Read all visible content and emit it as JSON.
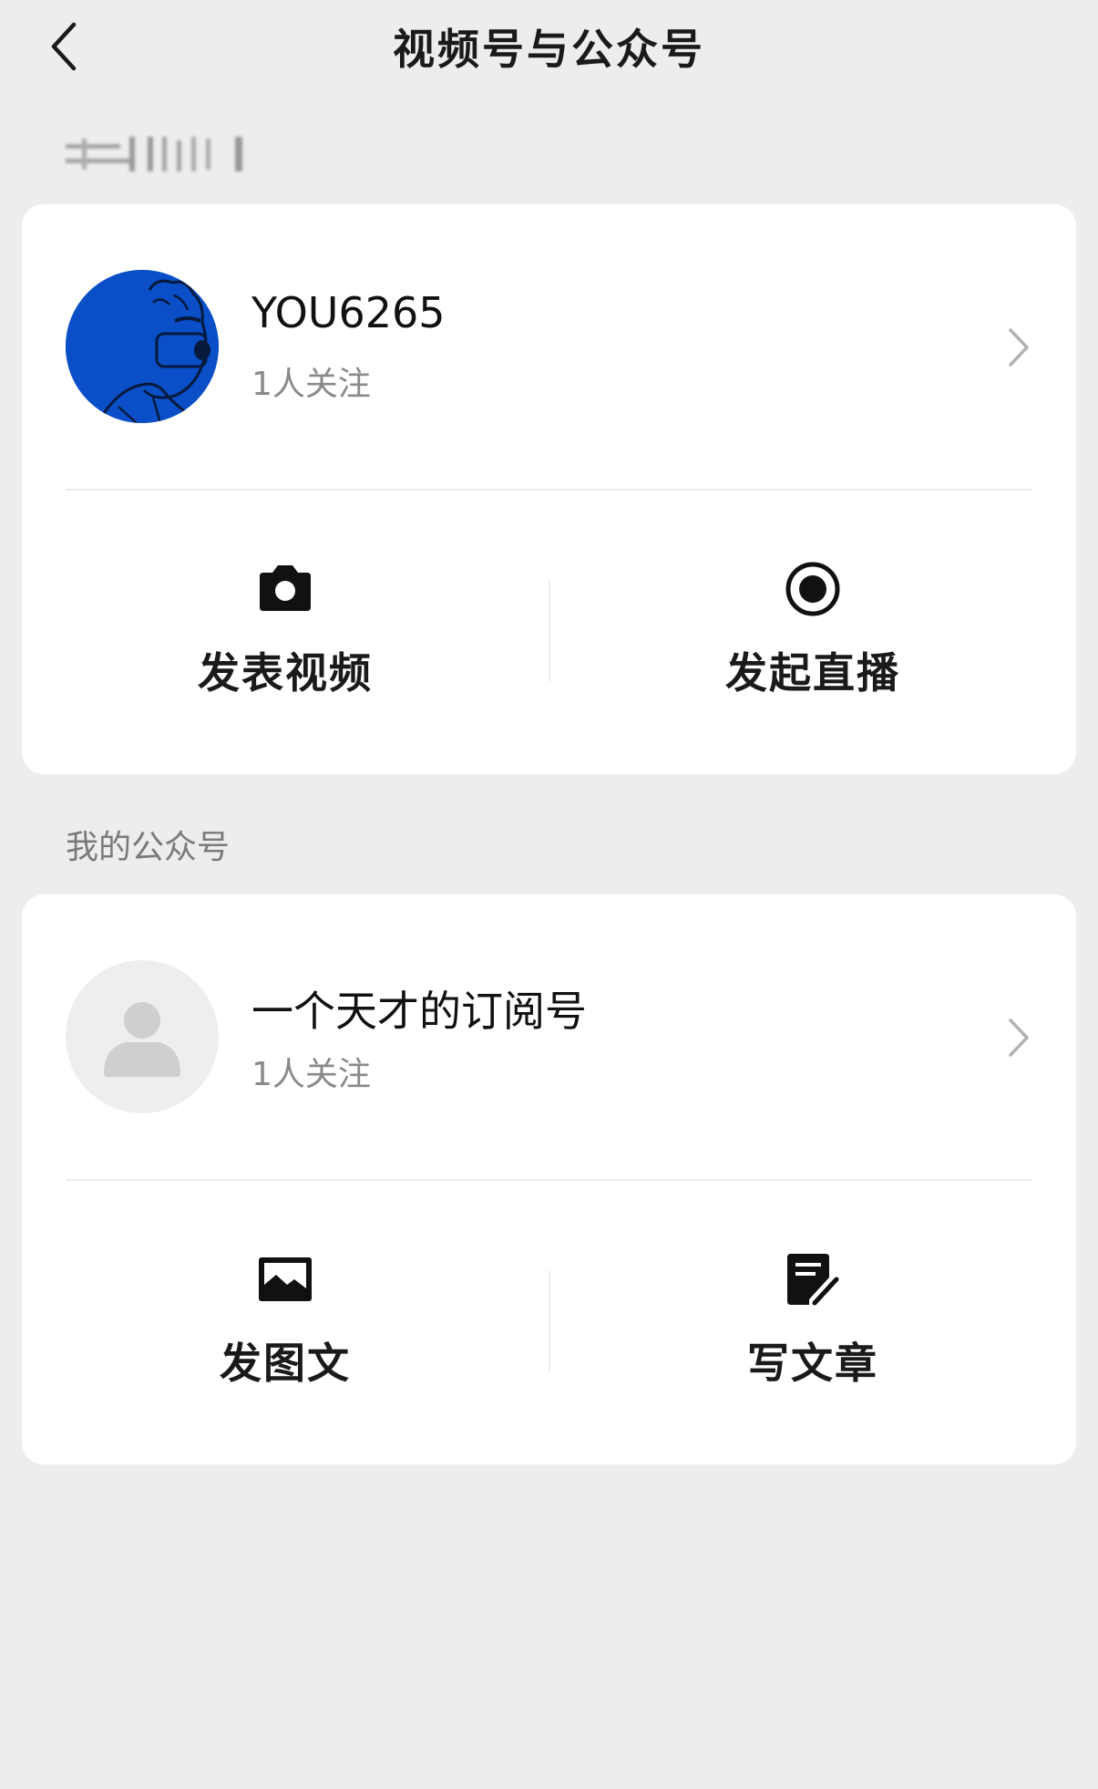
{
  "nav": {
    "title": "视频号与公众号",
    "back_icon": "chevron-left-icon"
  },
  "channels": {
    "name": "YOU6265",
    "followers": "1人关注",
    "avatar_color": "#0a4fc8",
    "actions": [
      {
        "label": "发表视频",
        "icon": "camera-icon"
      },
      {
        "label": "发起直播",
        "icon": "live-record-icon"
      }
    ]
  },
  "official_account": {
    "section_label": "我的公众号",
    "name": "一个天才的订阅号",
    "followers": "1人关注",
    "actions": [
      {
        "label": "发图文",
        "icon": "image-icon"
      },
      {
        "label": "写文章",
        "icon": "edit-document-icon"
      }
    ]
  },
  "colors": {
    "background": "#ededed",
    "card": "#ffffff",
    "secondary_text": "#8a8a8a"
  }
}
